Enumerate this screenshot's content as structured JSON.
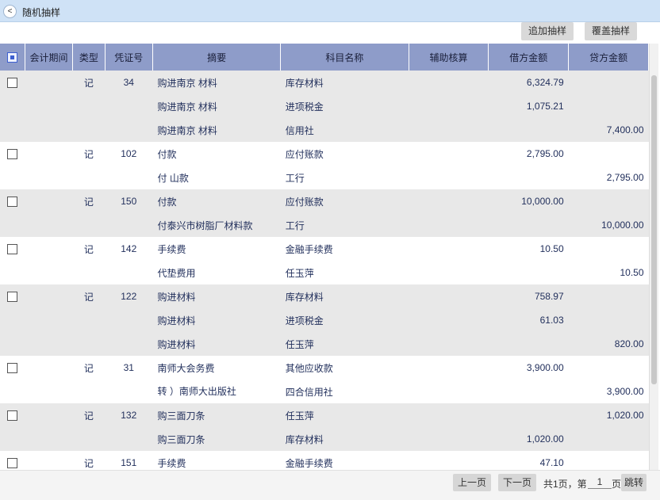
{
  "window": {
    "title": "随机抽样",
    "back_glyph": "<"
  },
  "toolbar": {
    "append_label": "追加抽样",
    "cover_label": "覆盖抽样"
  },
  "table": {
    "columns": [
      "",
      "会计期间",
      "类型",
      "凭证号",
      "摘要",
      "科目名称",
      "辅助核算",
      "借方金额",
      "贷方金额"
    ],
    "rows": [
      {
        "checkbox": true,
        "period": "",
        "type": "记",
        "voucher": "34",
        "summary": "购进南京   材料",
        "account": "库存材料",
        "aux": "",
        "debit": "6,324.79",
        "credit": ""
      },
      {
        "checkbox": false,
        "period": "",
        "type": "",
        "voucher": "",
        "summary": "购进南京   材料",
        "account": "进项税金",
        "aux": "",
        "debit": "1,075.21",
        "credit": ""
      },
      {
        "checkbox": false,
        "period": "",
        "type": "",
        "voucher": "",
        "summary": "购进南京   材料",
        "account": "   信用社",
        "aux": "",
        "debit": "",
        "credit": "7,400.00"
      },
      {
        "checkbox": true,
        "period": "",
        "type": "记",
        "voucher": "102",
        "summary": "付款",
        "account": "应付账款",
        "aux": "",
        "debit": "2,795.00",
        "credit": ""
      },
      {
        "checkbox": false,
        "period": "",
        "type": "",
        "voucher": "",
        "summary": "付    山款",
        "account": "工行",
        "aux": "",
        "debit": "",
        "credit": "2,795.00"
      },
      {
        "checkbox": true,
        "period": "",
        "type": "记",
        "voucher": "150",
        "summary": "付款",
        "account": "应付账款",
        "aux": "",
        "debit": "10,000.00",
        "credit": ""
      },
      {
        "checkbox": false,
        "period": "",
        "type": "",
        "voucher": "",
        "summary": "付泰兴市树脂厂材料款",
        "account": "工行",
        "aux": "",
        "debit": "",
        "credit": "10,000.00"
      },
      {
        "checkbox": true,
        "period": "",
        "type": "记",
        "voucher": "142",
        "summary": "手续费",
        "account": "金融手续费",
        "aux": "",
        "debit": "10.50",
        "credit": ""
      },
      {
        "checkbox": false,
        "period": "",
        "type": "",
        "voucher": "",
        "summary": "代垫费用",
        "account": "任玉萍",
        "aux": "",
        "debit": "",
        "credit": "10.50"
      },
      {
        "checkbox": true,
        "period": "",
        "type": "记",
        "voucher": "122",
        "summary": "购进材料",
        "account": "库存材料",
        "aux": "",
        "debit": "758.97",
        "credit": ""
      },
      {
        "checkbox": false,
        "period": "",
        "type": "",
        "voucher": "",
        "summary": "购进材料",
        "account": "进项税金",
        "aux": "",
        "debit": "61.03",
        "credit": ""
      },
      {
        "checkbox": false,
        "period": "",
        "type": "",
        "voucher": "",
        "summary": "购进材料",
        "account": "任玉萍",
        "aux": "",
        "debit": "",
        "credit": "820.00"
      },
      {
        "checkbox": true,
        "period": "",
        "type": "记",
        "voucher": "31",
        "summary": "南师大会务费",
        "account": "其他应收款",
        "aux": "",
        "debit": "3,900.00",
        "credit": ""
      },
      {
        "checkbox": false,
        "period": "",
        "type": "",
        "voucher": "",
        "summary": "转        ）南师大出版社",
        "account": "四合信用社",
        "aux": "",
        "debit": "",
        "credit": "3,900.00"
      },
      {
        "checkbox": true,
        "period": "",
        "type": "记",
        "voucher": "132",
        "summary": "购三面刀条",
        "account": "任玉萍",
        "aux": "",
        "debit": "",
        "credit": "1,020.00"
      },
      {
        "checkbox": false,
        "period": "",
        "type": "",
        "voucher": "",
        "summary": "购三面刀条",
        "account": "库存材料",
        "aux": "",
        "debit": "1,020.00",
        "credit": ""
      },
      {
        "checkbox": true,
        "period": "",
        "type": "记",
        "voucher": "151",
        "summary": "手续费",
        "account": "金融手续费",
        "aux": "",
        "debit": "47.10",
        "credit": ""
      }
    ],
    "groups": [
      {
        "start": 0,
        "count": 3,
        "shade": true
      },
      {
        "start": 3,
        "count": 2,
        "shade": false
      },
      {
        "start": 5,
        "count": 2,
        "shade": true
      },
      {
        "start": 7,
        "count": 2,
        "shade": false
      },
      {
        "start": 9,
        "count": 3,
        "shade": true
      },
      {
        "start": 12,
        "count": 2,
        "shade": false
      },
      {
        "start": 14,
        "count": 2,
        "shade": true
      },
      {
        "start": 16,
        "count": 1,
        "shade": false
      }
    ]
  },
  "pager": {
    "prev_label": "上一页",
    "next_label": "下一页",
    "info_text": "共1页，第",
    "page_value": "1",
    "unit_text": "页",
    "jump_label": "跳转"
  }
}
